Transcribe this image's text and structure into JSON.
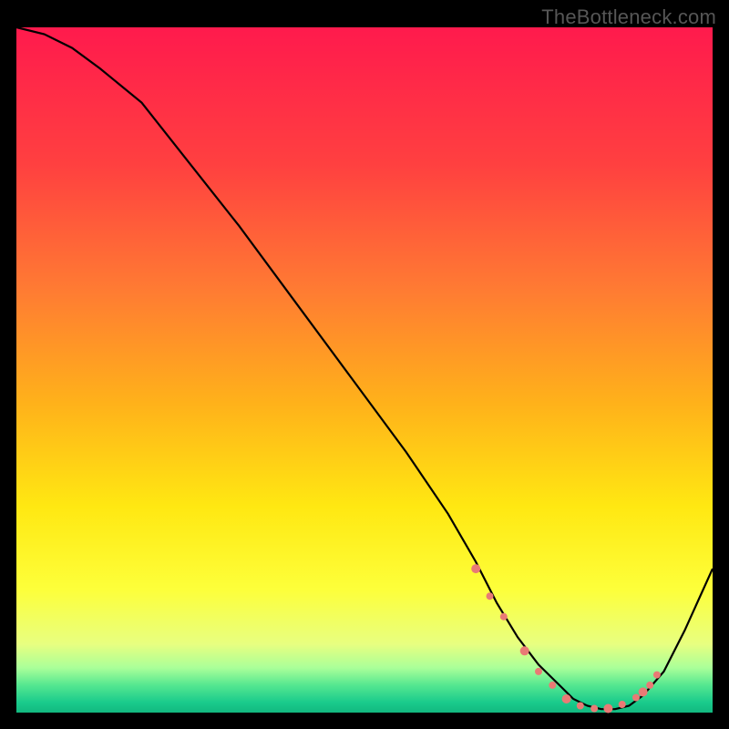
{
  "watermark": "TheBottleneck.com",
  "chart_data": {
    "type": "line",
    "title": "",
    "xlabel": "",
    "ylabel": "",
    "xlim": [
      0,
      100
    ],
    "ylim": [
      0,
      100
    ],
    "gradient_stops": [
      {
        "offset": 0.0,
        "color": "#ff1a4d"
      },
      {
        "offset": 0.2,
        "color": "#ff4040"
      },
      {
        "offset": 0.38,
        "color": "#ff7a33"
      },
      {
        "offset": 0.55,
        "color": "#ffb21a"
      },
      {
        "offset": 0.7,
        "color": "#ffe812"
      },
      {
        "offset": 0.82,
        "color": "#fdff3a"
      },
      {
        "offset": 0.9,
        "color": "#e8ff80"
      },
      {
        "offset": 0.935,
        "color": "#a9ff99"
      },
      {
        "offset": 0.96,
        "color": "#55e790"
      },
      {
        "offset": 0.985,
        "color": "#1acb8c"
      },
      {
        "offset": 1.0,
        "color": "#12b87f"
      }
    ],
    "series": [
      {
        "name": "bottleneck-curve",
        "x": [
          0,
          4,
          8,
          12,
          18,
          25,
          32,
          40,
          48,
          56,
          62,
          66,
          69,
          72,
          75,
          78,
          80,
          82,
          84,
          86,
          88,
          90,
          93,
          96,
          100
        ],
        "y": [
          100,
          99,
          97,
          94,
          89,
          80,
          71,
          60,
          49,
          38,
          29,
          22,
          16,
          11,
          7,
          4,
          2,
          1,
          0.5,
          0.5,
          1,
          2.5,
          6,
          12,
          21
        ]
      }
    ],
    "markers": {
      "name": "highlight-dots",
      "x": [
        66,
        68,
        70,
        73,
        75,
        77,
        79,
        81,
        83,
        85,
        87,
        89,
        90,
        91,
        92
      ],
      "y": [
        21,
        17,
        14,
        9,
        6,
        4,
        2,
        1,
        0.6,
        0.6,
        1.2,
        2.2,
        3,
        4,
        5.5
      ]
    }
  }
}
